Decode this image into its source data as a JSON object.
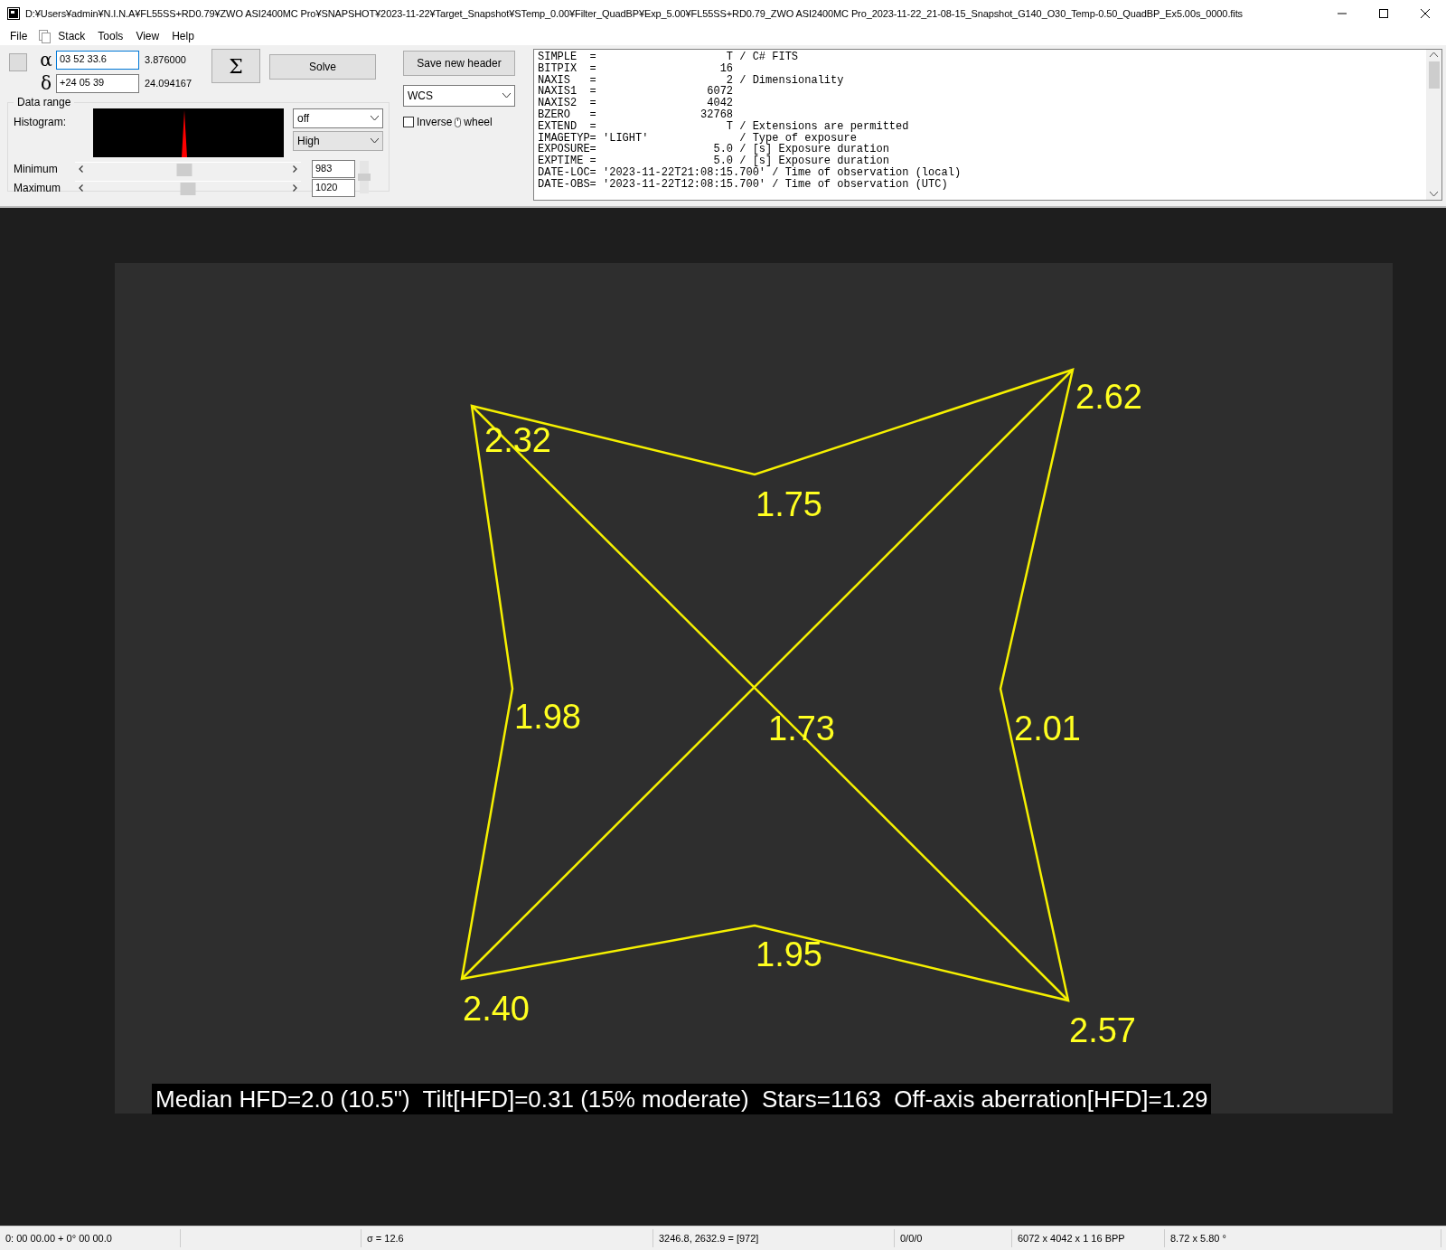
{
  "window": {
    "title": "D:¥Users¥admin¥N.I.N.A¥FL55SS+RD0.79¥ZWO ASI2400MC Pro¥SNAPSHOT¥2023-11-22¥Target_Snapshot¥STemp_0.00¥Filter_QuadBP¥Exp_5.00¥FL55SS+RD0.79_ZWO ASI2400MC Pro_2023-11-22_21-08-15_Snapshot_G140_O30_Temp-0.50_QuadBP_Ex5.00s_0000.fits"
  },
  "menu": [
    "File",
    "Stack",
    "Tools",
    "View",
    "Help"
  ],
  "coords": {
    "ra_label": "α",
    "ra_value": "03 52 33.6",
    "ra_decimal": "3.876000",
    "dec_label": "δ",
    "dec_value": "+24 05 39",
    "dec_decimal": "24.094167"
  },
  "buttons": {
    "sum": "Σ",
    "solve": "Solve",
    "save_header": "Save new header"
  },
  "projection": {
    "value": "WCS"
  },
  "inverse_wheel": {
    "label": "Inverse",
    "suffix": "wheel",
    "checked": false
  },
  "data_range": {
    "title": "Data range",
    "histogram_label": "Histogram:",
    "stretch": "off",
    "quality": "High",
    "minimum": {
      "label": "Minimum",
      "value": "983",
      "level": 0.48
    },
    "maximum": {
      "label": "Maximum",
      "value": "1020",
      "level": 0.5
    },
    "contrast": {
      "level": 0.5
    }
  },
  "fits_header": [
    "SIMPLE  =                    T / C# FITS",
    "BITPIX  =                   16",
    "NAXIS   =                    2 / Dimensionality",
    "NAXIS1  =                 6072",
    "NAXIS2  =                 4042",
    "BZERO   =                32768",
    "EXTEND  =                    T / Extensions are permitted",
    "IMAGETYP= 'LIGHT'              / Type of exposure",
    "EXPOSURE=                  5.0 / [s] Exposure duration",
    "EXPTIME =                  5.0 / [s] Exposure duration",
    "DATE-LOC= '2023-11-22T21:08:15.700' / Time of observation (local)",
    "DATE-OBS= '2023-11-22T12:08:15.700' / Time of observation (UTC)"
  ],
  "overlay": {
    "labels": [
      "2.32",
      "1.75",
      "2.62",
      "1.98",
      "1.73",
      "2.01",
      "1.95",
      "2.40",
      "2.57"
    ],
    "caption": "Median HFD=2.0 (10.5\")  Tilt[HFD]=0.31 (15% moderate)  Stars=1163  Off-axis aberration[HFD]=1.29"
  },
  "status_bar": [
    "0: 00  00.00   + 0° 00  00.0",
    "σ = 12.6",
    "3246.8, 2632.9 = [972]",
    "0/0/0",
    "6072 x 4042 x 1   16 BPP",
    "8.72 x 5.80 °"
  ]
}
